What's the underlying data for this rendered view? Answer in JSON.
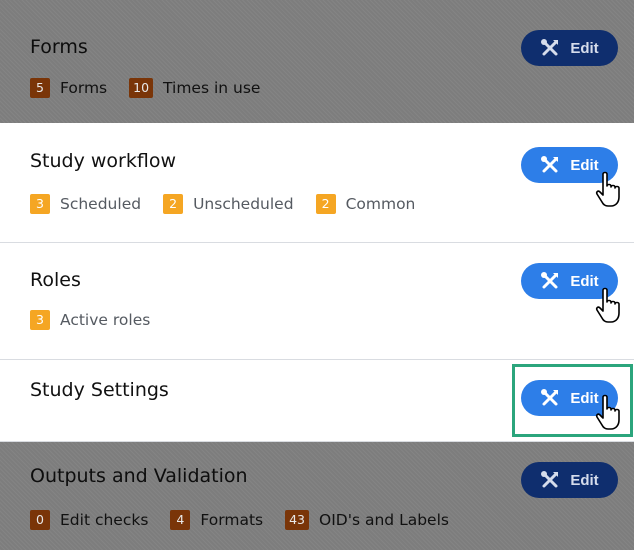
{
  "sections": [
    {
      "title": "Forms",
      "counts": [
        {
          "value": "5",
          "label": "Forms"
        },
        {
          "value": "10",
          "label": "Times in use"
        }
      ],
      "edit_label": "Edit"
    },
    {
      "title": "Study workflow",
      "counts": [
        {
          "value": "3",
          "label": "Scheduled"
        },
        {
          "value": "2",
          "label": "Unscheduled"
        },
        {
          "value": "2",
          "label": "Common"
        }
      ],
      "edit_label": "Edit"
    },
    {
      "title": "Roles",
      "counts": [
        {
          "value": "3",
          "label": "Active roles"
        }
      ],
      "edit_label": "Edit"
    },
    {
      "title": "Study Settings",
      "edit_label": "Edit"
    },
    {
      "title": "Outputs and Validation",
      "counts": [
        {
          "value": "0",
          "label": "Edit checks"
        },
        {
          "value": "4",
          "label": "Formats"
        },
        {
          "value": "43",
          "label": "OID's and Labels"
        }
      ],
      "edit_label": "Edit"
    }
  ],
  "icons": {
    "edit": "tools-icon",
    "pointer": "hand-pointer-icon"
  },
  "colors": {
    "accent": "#2d7ee8",
    "badge": "#f5a623",
    "dim_accent": "#0f2e6e",
    "dim_badge": "#7a3508",
    "highlight": "#2ba57c"
  }
}
